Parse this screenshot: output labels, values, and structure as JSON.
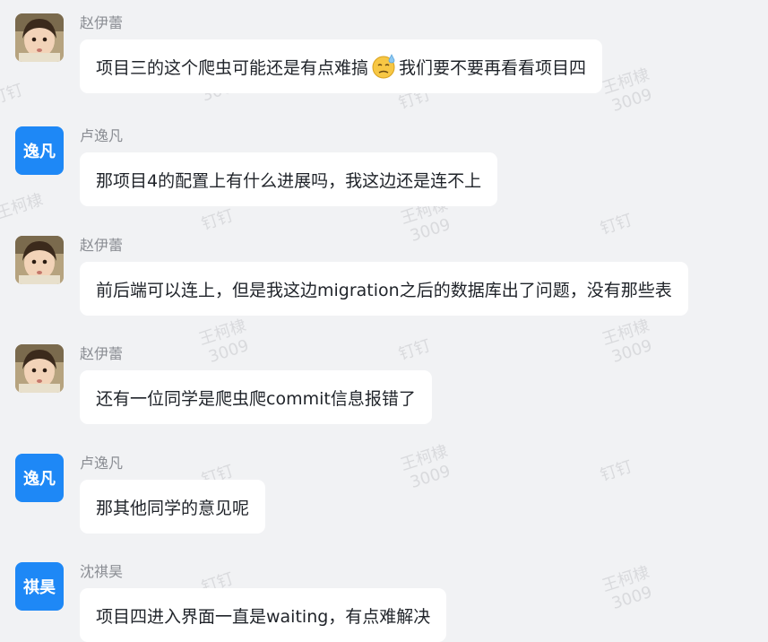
{
  "watermark": {
    "name": "王柯棣",
    "id": "3009",
    "app": "钉钉"
  },
  "messages": [
    {
      "sender": "赵伊蕾",
      "avatar_type": "photo",
      "avatar_text": "",
      "text_before": "项目三的这个爬虫可能还是有点难搞",
      "emoji": "sweat-emoji-icon",
      "text_after": "我们要不要再看看项目四"
    },
    {
      "sender": "卢逸凡",
      "avatar_type": "text",
      "avatar_text": "逸凡",
      "text_before": "那项目4的配置上有什么进展吗，我这边还是连不上",
      "emoji": "",
      "text_after": ""
    },
    {
      "sender": "赵伊蕾",
      "avatar_type": "photo",
      "avatar_text": "",
      "text_before": "前后端可以连上，但是我这边migration之后的数据库出了问题，没有那些表",
      "emoji": "",
      "text_after": ""
    },
    {
      "sender": "赵伊蕾",
      "avatar_type": "photo",
      "avatar_text": "",
      "text_before": "还有一位同学是爬虫爬commit信息报错了",
      "emoji": "",
      "text_after": ""
    },
    {
      "sender": "卢逸凡",
      "avatar_type": "text",
      "avatar_text": "逸凡",
      "text_before": "那其他同学的意见呢",
      "emoji": "",
      "text_after": ""
    },
    {
      "sender": "沈祺昊",
      "avatar_type": "text",
      "avatar_text": "祺昊",
      "text_before": "项目四进入界面一直是waiting，有点难解决",
      "emoji": "",
      "text_after": ""
    }
  ],
  "colors": {
    "background": "#f1f2f4",
    "bubble": "#ffffff",
    "avatar_blue": "#1e88f6",
    "sender_gray": "#8a8d93",
    "text": "#1f2329",
    "watermark": "#d9dadd"
  }
}
